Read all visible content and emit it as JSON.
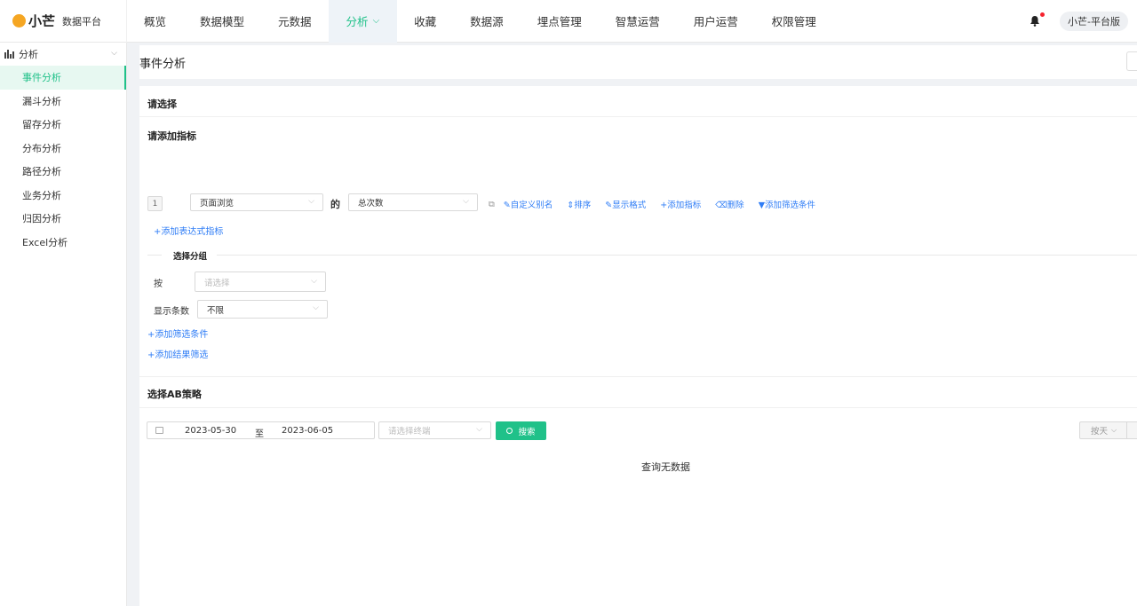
{
  "brand": {
    "name": "小芒",
    "subtitle": "数据平台"
  },
  "nav": {
    "items": [
      "概览",
      "数据模型",
      "元数据",
      "分析",
      "收藏",
      "数据源",
      "埋点管理",
      "智慧运营",
      "用户运营",
      "权限管理"
    ],
    "active": "分析"
  },
  "user": {
    "label": "小芒-平台版"
  },
  "sidebar": {
    "group": "分析",
    "items": [
      "事件分析",
      "漏斗分析",
      "留存分析",
      "分布分析",
      "路径分析",
      "业务分析",
      "归因分析",
      "Excel分析"
    ],
    "active": "事件分析"
  },
  "page": {
    "title": "事件分析"
  },
  "selection": {
    "title": "请选择",
    "metrics_title": "请添加指标",
    "metric": {
      "index": "1",
      "event": "页面浏览",
      "connector": "的",
      "measure": "总次数",
      "actions": [
        "自定义别名",
        "排序",
        "显示格式",
        "添加指标",
        "删除",
        "添加筛选条件"
      ]
    },
    "add_expression": "+添加表达式指标",
    "group_title": "选择分组",
    "by_label": "按",
    "by_placeholder": "请选择",
    "count_label": "显示条数",
    "count_value": "不限",
    "add_filter": "+添加筛选条件",
    "add_result_filter": "+添加结果筛选"
  },
  "ab": {
    "title": "选择AB策略"
  },
  "query": {
    "start_date": "2023-05-30",
    "to": "至",
    "end_date": "2023-06-05",
    "terminal_placeholder": "请选择终端",
    "search_label": "搜索",
    "granularity": "按天"
  },
  "result": {
    "empty": "查询无数据"
  },
  "colors": {
    "accent": "#20c189",
    "link": "#2f7df6",
    "notify": "#f5222d",
    "brand": "#f5a623"
  }
}
